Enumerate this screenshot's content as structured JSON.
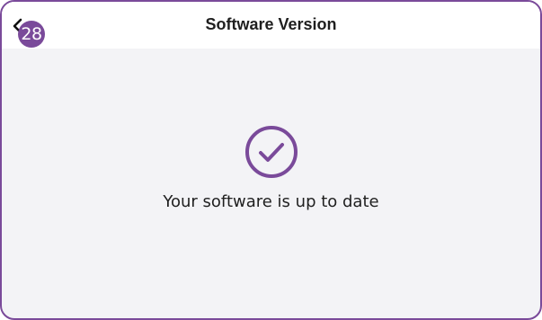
{
  "header": {
    "title": "Software Version",
    "back_icon": "chevron-left-icon",
    "badge": "28"
  },
  "main": {
    "status_icon": "check-circle-icon",
    "message": "Your software is up to date"
  },
  "colors": {
    "accent": "#7a4a9a",
    "background": "#f3f3f6",
    "header_background": "#ffffff",
    "text": "#1f1f1f"
  }
}
